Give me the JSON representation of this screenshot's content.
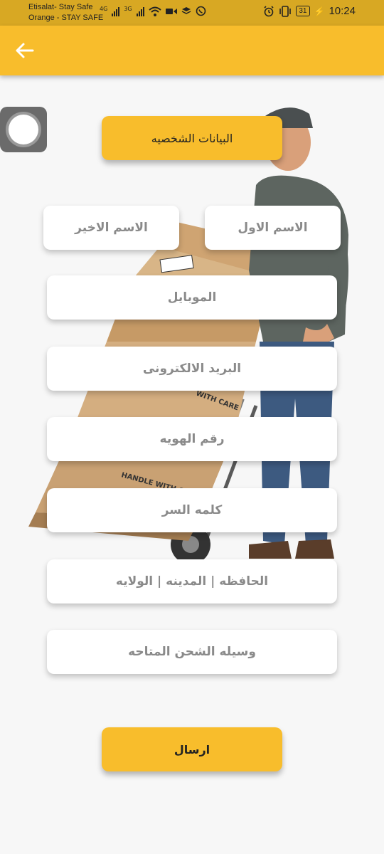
{
  "status_bar": {
    "carrier_line1": "Etisalat- Stay Safe",
    "carrier_line2": "Orange - STAY SAFE",
    "net1": "4G",
    "net2": "3G",
    "battery": "31",
    "time": "10:24"
  },
  "app_bar": {
    "back_icon": "arrow-left-icon",
    "color": "#f8bd2c"
  },
  "form": {
    "section_title": "البيانات الشخصيه",
    "first_name_placeholder": "الاسم الاول",
    "last_name_placeholder": "الاسم الاخير",
    "mobile_placeholder": "الموبايل",
    "email_placeholder": "البريد الالكترونى",
    "id_placeholder": "رقم الهويه",
    "password_placeholder": "كلمه السر",
    "region_placeholder": "الحافظه | المدينه | الولايه",
    "shipping_placeholder": "وسيله الشحن المتاحه",
    "submit_label": "ارسال"
  },
  "box_label_1": "HANDLE WITH CARE",
  "box_label_2": "WITH CARE"
}
